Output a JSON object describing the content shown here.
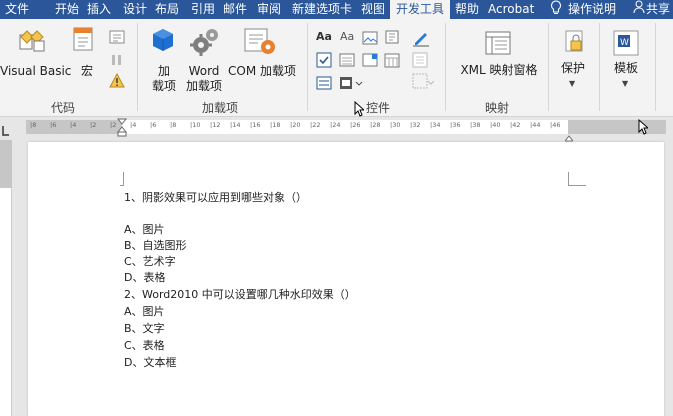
{
  "tabs": [
    "文件",
    "开始",
    "插入",
    "设计",
    "布局",
    "引用",
    "邮件",
    "审阅",
    "新建选项卡",
    "视图",
    "开发工具",
    "帮助",
    "Acrobat",
    "操作说明",
    "共享"
  ],
  "active_tab": "开发工具",
  "ribbon": {
    "groups": {
      "code": "代码",
      "addins": "加载项",
      "controls": "控件",
      "mapping": "映射"
    },
    "buttons": {
      "visual_basic": "Visual Basic",
      "macro": "宏",
      "addins": "加\n载项",
      "word_addins": "Word\n加载项",
      "com_addins": "COM 加载项",
      "xml_mapping": "XML 映射窗格",
      "protect": "保护",
      "template": "模板"
    }
  },
  "document": {
    "lines": [
      "1、阴影效果可以应用到哪些对象（）",
      "",
      "A、图片",
      "B、自选图形",
      "C、艺术字",
      "D、表格",
      "2、Word2010 中可以设置哪几种水印效果（）",
      "A、图片",
      "B、文字",
      "C、表格",
      "D、文本框"
    ]
  },
  "ruler_ticks": [
    "8",
    "6",
    "4",
    "2",
    "2",
    "4",
    "6",
    "8",
    "10",
    "12",
    "14",
    "16",
    "18",
    "20",
    "22",
    "24",
    "26",
    "28",
    "30",
    "32",
    "34",
    "36",
    "38",
    "40",
    "42",
    "44",
    "46"
  ],
  "colors": {
    "tabbar": "#2b579a",
    "ribbon": "#f3f3f3",
    "accent_blue": "#2b579a",
    "gear": "#7f7f7f",
    "orange": "#e8812f"
  }
}
